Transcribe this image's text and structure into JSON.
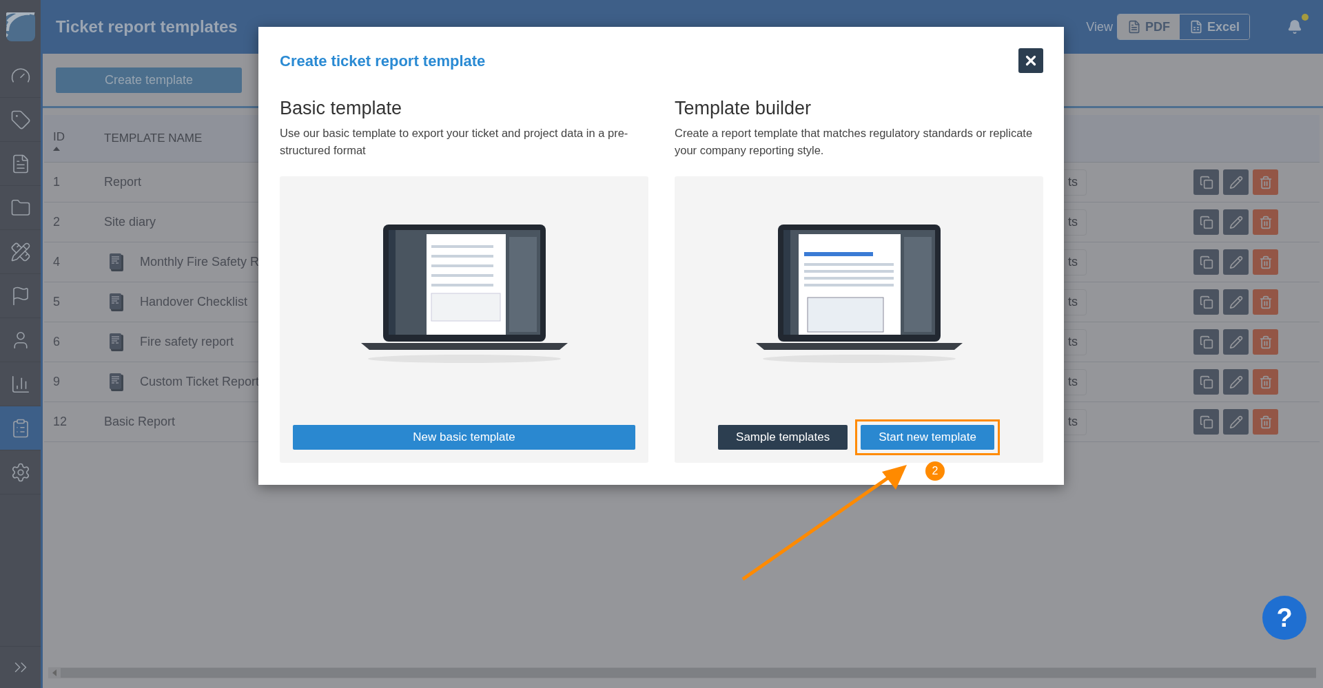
{
  "sidebar": {
    "items": [
      {
        "kind": "gauge",
        "selected": false
      },
      {
        "kind": "tag",
        "selected": false
      },
      {
        "kind": "report",
        "selected": false
      },
      {
        "kind": "folder",
        "selected": false
      },
      {
        "kind": "tools",
        "selected": false
      },
      {
        "kind": "flag",
        "selected": false
      },
      {
        "kind": "user",
        "selected": false
      },
      {
        "kind": "chart",
        "selected": false
      },
      {
        "kind": "clipboard",
        "selected": true
      },
      {
        "kind": "settings",
        "selected": false
      }
    ]
  },
  "header": {
    "title": "Ticket report templates",
    "view_label": "View",
    "view_options": [
      {
        "label": "PDF",
        "kind": "pdf",
        "selected": true
      },
      {
        "label": "Excel",
        "kind": "excel",
        "selected": false
      }
    ],
    "unread_notifications": true
  },
  "toolbar": {
    "create_button": "Create template"
  },
  "table": {
    "columns": [
      {
        "label": "ID"
      },
      {
        "label": "TEMPLATE NAME"
      }
    ],
    "rows": [
      {
        "id": "1",
        "name": "Report",
        "custom": false,
        "column_3": "ts"
      },
      {
        "id": "2",
        "name": "Site diary",
        "custom": false,
        "column_3": "ts"
      },
      {
        "id": "4",
        "name": "Monthly Fire Safety R",
        "custom": true,
        "column_3": "ts"
      },
      {
        "id": "5",
        "name": "Handover Checklist",
        "custom": true,
        "column_3": "ts"
      },
      {
        "id": "6",
        "name": "Fire safety report",
        "custom": true,
        "column_3": "ts"
      },
      {
        "id": "9",
        "name": "Custom Ticket Report",
        "custom": true,
        "column_3": "ts"
      },
      {
        "id": "12",
        "name": "Basic Report",
        "custom": false,
        "column_3": "ts"
      }
    ]
  },
  "help_button": "?",
  "modal": {
    "title": "Create ticket report template",
    "sections": [
      {
        "kind": "basic",
        "heading": "Basic template",
        "description": "Use our basic template to export your ticket and project data in a pre-structured format",
        "buttons": [
          {
            "label": "New basic template",
            "kind": "primary",
            "highlighted": false
          }
        ]
      },
      {
        "kind": "builder",
        "heading": "Template builder",
        "description": "Create a report template that matches regulatory standards or replicate your company reporting style.",
        "buttons": [
          {
            "label": "Sample templates",
            "kind": "dark",
            "highlighted": false
          },
          {
            "label": "Start new template",
            "kind": "primary",
            "highlighted": true
          }
        ]
      }
    ]
  },
  "annotation": {
    "step": "2"
  }
}
